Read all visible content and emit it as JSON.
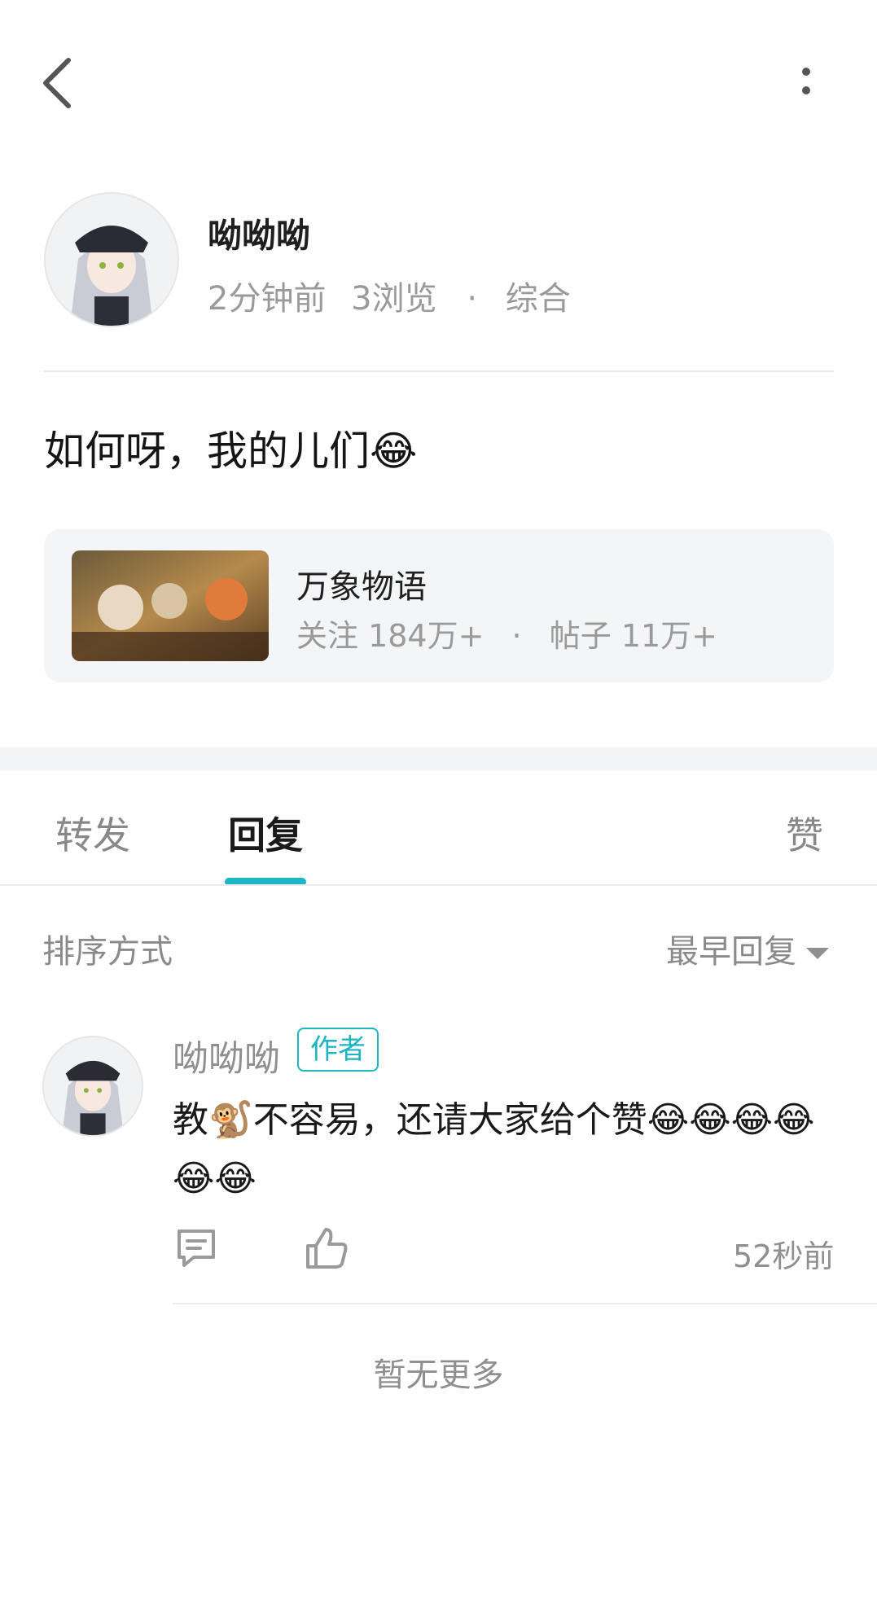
{
  "header": {
    "back_icon": "chevron-left-icon",
    "more_icon": "more-vertical-icon"
  },
  "post": {
    "author": "呦呦呦",
    "time": "2分钟前",
    "views": "3浏览",
    "separator": "·",
    "category": "综合",
    "content": "如何呀，我的儿们😂"
  },
  "forum": {
    "name": "万象物语",
    "followers": "关注 184万+",
    "separator": "·",
    "posts": "帖子 11万+"
  },
  "tabs": {
    "forward": "转发",
    "reply": "回复",
    "like": "赞",
    "active": "reply",
    "accent_color": "#1bb5c4"
  },
  "sort": {
    "label": "排序方式",
    "value": "最早回复"
  },
  "comment": {
    "author": "呦呦呦",
    "badge": "作者",
    "text": "教🐒不容易，还请大家给个赞😂😂😂😂😂😂",
    "time": "52秒前"
  },
  "footer": {
    "no_more": "暂无更多"
  }
}
